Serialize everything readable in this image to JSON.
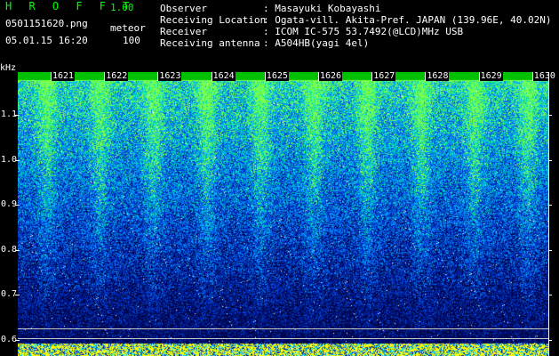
{
  "header": {
    "app_title": "H R O F F T",
    "app_version": "1.00",
    "file_name": "0501151620.png",
    "mode": "meteor",
    "timestamp": "05.01.15 16:20",
    "count": "100",
    "info": [
      {
        "label": "Observer",
        "value": ": Masayuki Kobayashi"
      },
      {
        "label": "Receiving Location",
        "value": ": Ogata-vill. Akita-Pref. JAPAN (139.96E, 40.02N)"
      },
      {
        "label": "Receiver",
        "value": ": ICOM IC-575 53.7492(@LCD)MHz USB"
      },
      {
        "label": "Receiving antenna",
        "value": ": A504HB(yagi 4el)"
      }
    ]
  },
  "axis": {
    "unit": "kHz",
    "y_labels": [
      "1.1",
      "1.0",
      "0.9",
      "0.8",
      "0.7",
      "0.6"
    ],
    "minute_labels": [
      "1621",
      "1622",
      "1623",
      "1624",
      "1625",
      "1626",
      "1627",
      "1628",
      "1629",
      "1630"
    ]
  },
  "colors": {
    "title": "#00ff00",
    "signal_high": "#00ff00",
    "signal_mid": "#0080ff",
    "noise_bg": "#001090",
    "baseline_noise": "#ffff00"
  }
}
